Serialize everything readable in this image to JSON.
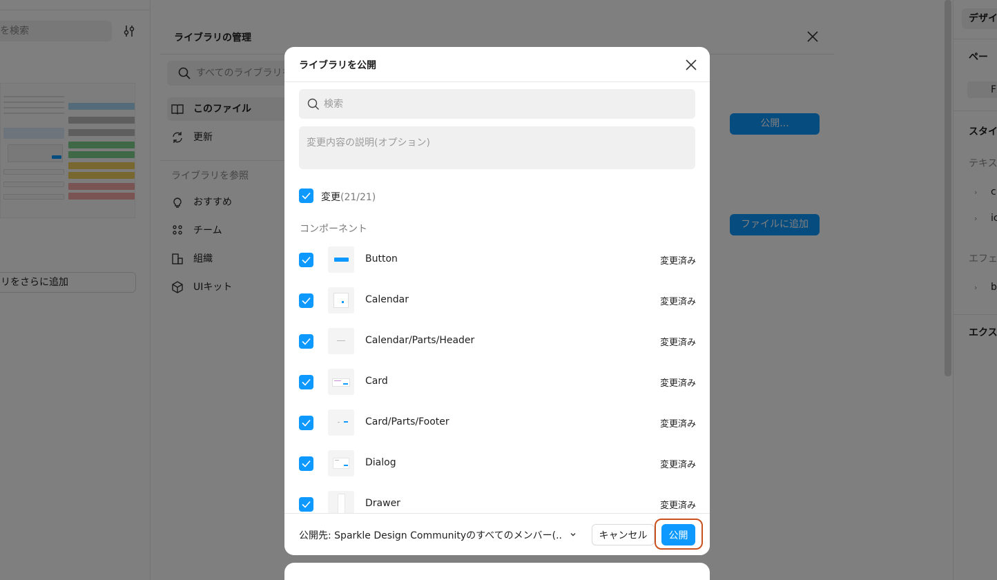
{
  "background": {
    "left_panel": {
      "search_placeholder": "を検索",
      "add_library_label": "リをさらに追加"
    },
    "right_panel": {
      "design_tab": "デザイ",
      "page_label": "ペー",
      "page_item": "F",
      "styles_label": "スタイ",
      "text_label": "テキス",
      "text_item_1": "cl",
      "text_item_2": "ic",
      "effects_label": "エフェ",
      "effects_item": "b",
      "export_label": "エクス"
    },
    "manage_modal": {
      "title": "ライブラリの管理",
      "search_placeholder": "すべてのライブラリを",
      "nav": [
        {
          "label": "このファイル",
          "icon": "book-icon",
          "selected": true
        },
        {
          "label": "更新",
          "icon": "refresh-icon",
          "selected": false
        }
      ],
      "browse_section": "ライブラリを参照",
      "browse_nav": [
        {
          "label": "おすすめ",
          "icon": "lightbulb-icon"
        },
        {
          "label": "チーム",
          "icon": "team-icon"
        },
        {
          "label": "組織",
          "icon": "building-icon"
        },
        {
          "label": "UIキット",
          "icon": "package-icon"
        }
      ],
      "publish_button": "公開...",
      "add_to_file_button": "ファイルに追加"
    }
  },
  "dialog": {
    "title": "ライブラリを公開",
    "search_placeholder": "検索",
    "description_placeholder": "変更内容の説明(オプション)",
    "changes_label": "変更",
    "changes_count": "(21/21)",
    "section_label": "コンポーネント",
    "components": [
      {
        "name": "Button",
        "status": "変更済み",
        "checked": true,
        "thumb": "button"
      },
      {
        "name": "Calendar",
        "status": "変更済み",
        "checked": true,
        "thumb": "calendar"
      },
      {
        "name": "Calendar/Parts/Header",
        "status": "変更済み",
        "checked": true,
        "thumb": "header"
      },
      {
        "name": "Card",
        "status": "変更済み",
        "checked": true,
        "thumb": "card"
      },
      {
        "name": "Card/Parts/Footer",
        "status": "変更済み",
        "checked": true,
        "thumb": "footer"
      },
      {
        "name": "Dialog",
        "status": "変更済み",
        "checked": true,
        "thumb": "dialog"
      },
      {
        "name": "Drawer",
        "status": "変更済み",
        "checked": true,
        "thumb": "drawer"
      }
    ],
    "publish_to": "公開先: Sparkle Design Communityのすべてのメンバー(...",
    "cancel_button": "キャンセル",
    "publish_button": "公開"
  },
  "colors": {
    "accent": "#0d99ff",
    "highlight_ring": "#c8501c",
    "overlay": "rgba(0,0,0,0.5)"
  }
}
